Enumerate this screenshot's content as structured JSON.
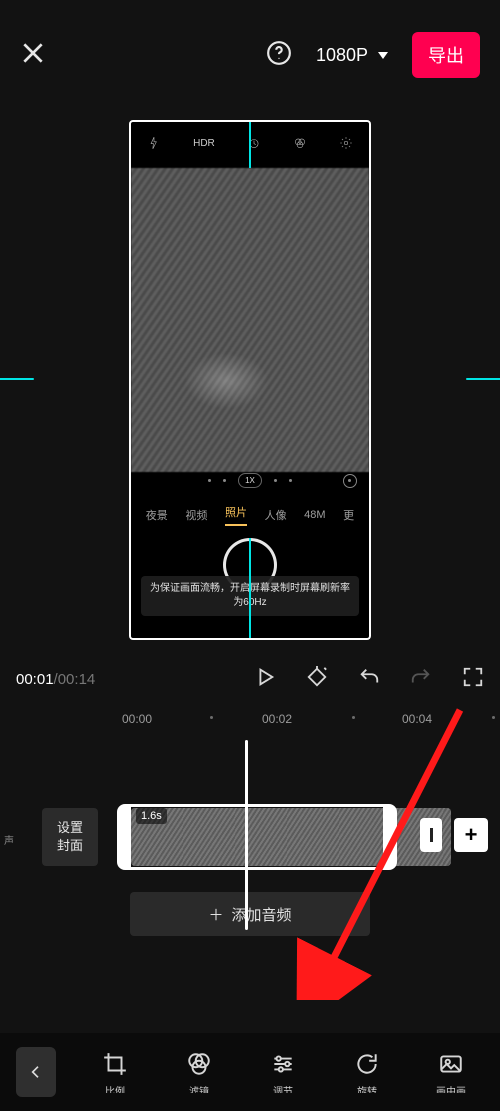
{
  "header": {
    "resolution_label": "1080P",
    "export_label": "导出"
  },
  "preview": {
    "inner_camera": {
      "top_icons": [
        "flash",
        "HDR",
        "timer",
        "filter",
        "settings"
      ],
      "hdr_label": "HDR",
      "zoom_label": "1X",
      "tabs": {
        "night": "夜景",
        "video": "视频",
        "photo": "照片",
        "portrait": "人像",
        "m48": "48M",
        "more": "更"
      },
      "tip_text": "为保证画面流畅，开启屏幕录制时屏幕刷新率为60Hz"
    }
  },
  "transport": {
    "current_time": "00:01",
    "total_time": "00:14"
  },
  "timeline": {
    "ticks": [
      "00:00",
      "00:02",
      "00:04"
    ],
    "track_label": "声",
    "cover_label": "设置\n封面",
    "duration_badge": "1.6s",
    "add_audio_label": "添加音频"
  },
  "toolbar": {
    "items": [
      {
        "id": "crop",
        "label": "比例"
      },
      {
        "id": "filter",
        "label": "滤镜"
      },
      {
        "id": "adjust",
        "label": "调节"
      },
      {
        "id": "rotate",
        "label": "旋转"
      },
      {
        "id": "image",
        "label": "画中画"
      }
    ]
  }
}
